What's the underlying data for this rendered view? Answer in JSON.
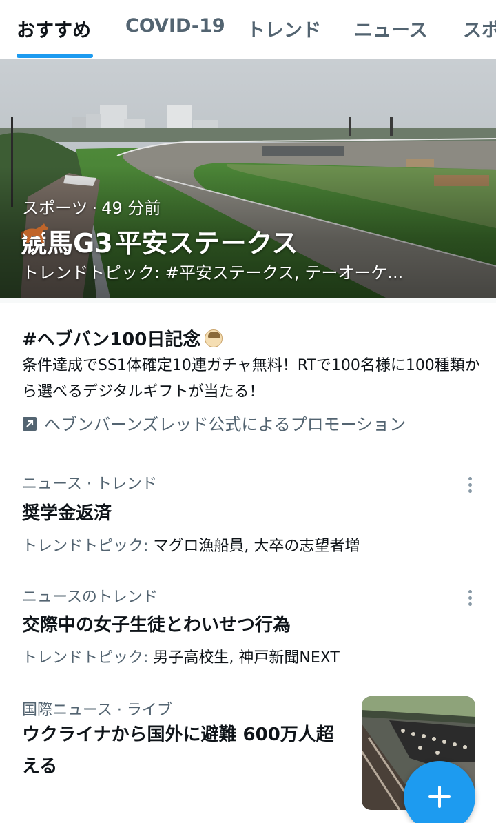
{
  "tabs": [
    {
      "label": "おすすめ",
      "active": true
    },
    {
      "label": "COVID-19",
      "active": false
    },
    {
      "label": "トレンド",
      "active": false
    },
    {
      "label": "ニュース",
      "active": false
    },
    {
      "label": "スポ",
      "active": false
    }
  ],
  "accent_color": "#1d9bf0",
  "hero": {
    "category": "スポーツ",
    "separator": "·",
    "time": "49 分前",
    "title_prefix": "競馬G3",
    "title_emoji": "horse-emoji",
    "title_suffix": "平安ステークス",
    "subtitle": "トレンドトピック: #平安ステークス, テーオーケ..."
  },
  "promo": {
    "title": "#ヘブバン100日記念",
    "title_emoji": "character-face-emoji",
    "body": "条件達成でSS1体確定10連ガチャ無料！RTで100名様に100種類から選べるデジタルギフトが当たる！",
    "promoted_by": "ヘブンバーンズレッド公式によるプロモーション",
    "promoted_icon": "promoted-arrow-icon"
  },
  "trends": [
    {
      "meta": "ニュース · トレンド",
      "title": "奨学金返済",
      "topics_label": "トレンドトピック: ",
      "topics": "マグロ漁船員, 大卒の志望者増"
    },
    {
      "meta": "ニュースのトレンド",
      "title": "交際中の女子生徒とわいせつ行為",
      "topics_label": "トレンドトピック: ",
      "topics": "男子高校生, 神戸新聞NEXT"
    }
  ],
  "last_item": {
    "category": "国際ニュース",
    "separator": " · ",
    "status": "ライブ",
    "title": "ウクライナから国外に避難 600万人超える"
  },
  "fab_icon": "plus-icon"
}
